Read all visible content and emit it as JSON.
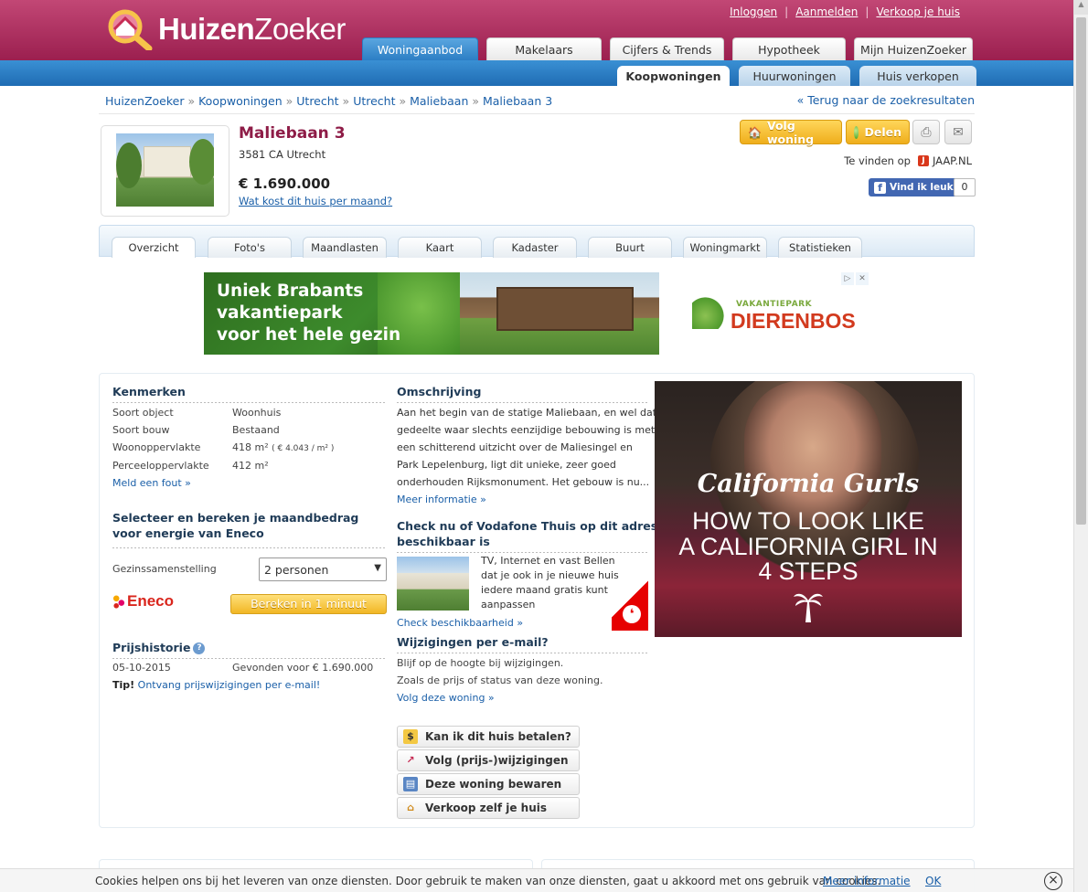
{
  "header": {
    "logo_part1": "Huizen",
    "logo_part2": "Zoeker",
    "top_links": [
      "Inloggen",
      "Aanmelden",
      "Verkoop je huis"
    ],
    "main_tabs": [
      "Woningaanbod",
      "Makelaars",
      "Cijfers & Trends",
      "Hypotheek",
      "Mijn HuizenZoeker"
    ],
    "sub_tabs": [
      "Koopwoningen",
      "Huurwoningen",
      "Huis verkopen"
    ]
  },
  "breadcrumb": [
    "HuizenZoeker",
    "Koopwoningen",
    "Utrecht",
    "Utrecht",
    "Maliebaan",
    "Maliebaan 3"
  ],
  "back_link": "« Terug naar de zoekresultaten",
  "listing": {
    "title": "Maliebaan 3",
    "address": "3581 CA Utrecht",
    "price": "€ 1.690.000",
    "cost_link": "Wat kost dit huis per maand?",
    "follow_button": "Volg woning",
    "share_button": "Delen",
    "found_on_label": "Te vinden op",
    "found_on_site": "JAAP.NL",
    "fb_like": "Vind ik leuk",
    "fb_count": "0"
  },
  "page_tabs": [
    "Overzicht",
    "Foto's",
    "Maandlasten",
    "Kaart",
    "Kadaster",
    "Buurt",
    "Woningmarkt",
    "Statistieken"
  ],
  "ad_banner": {
    "slogan_line1": "Uniek Brabants",
    "slogan_line2": "vakantiepark",
    "slogan_line3": "voor het hele gezin",
    "brand_small": "VAKANTIEPARK",
    "brand_big": "DIERENBOS"
  },
  "kenmerken": {
    "heading": "Kenmerken",
    "rows": [
      {
        "label": "Soort object",
        "value": "Woonhuis"
      },
      {
        "label": "Soort bouw",
        "value": "Bestaand"
      },
      {
        "label": "Woonoppervlakte",
        "value": "418 m²",
        "extra": "( € 4.043 / m² )"
      },
      {
        "label": "Perceeloppervlakte",
        "value": "412 m²"
      }
    ],
    "report_link": "Meld een fout »"
  },
  "energy": {
    "heading_line1": "Selecteer en bereken je maandbedrag",
    "heading_line2": "voor energie van Eneco",
    "household_label": "Gezinssamenstelling",
    "household_value": "2 personen",
    "brand": "Eneco",
    "calc_button": "Bereken in 1 minuut"
  },
  "price_history": {
    "heading": "Prijshistorie",
    "date": "05-10-2015",
    "entry": "Gevonden voor € 1.690.000",
    "tip_label": "Tip!",
    "tip_link": "Ontvang prijswijzigingen per e-mail!"
  },
  "description": {
    "heading": "Omschrijving",
    "lines": [
      "Aan het begin van de statige Maliebaan, en wel dat",
      "gedeelte waar slechts eenzijdige bebouwing is met",
      "een schitterend uitzicht over de Maliesingel en",
      "Park Lepelenburg, ligt dit unieke, zeer goed",
      "onderhouden Rijksmonument. Het gebouw is nu..."
    ],
    "more_link": "Meer informatie »"
  },
  "vodafone": {
    "heading_line1": "Check nu of Vodafone Thuis op dit adres",
    "heading_line2": "beschikbaar is",
    "lines": [
      "TV, Internet en vast Bellen",
      "dat je ook in je nieuwe huis",
      "iedere maand gratis kunt",
      "aanpassen"
    ],
    "link": "Check beschikbaarheid »"
  },
  "email_changes": {
    "heading": "Wijzigingen per e-mail?",
    "line1": "Blijf op de hoogte bij wijzigingen.",
    "line2": "Zoals de prijs of status van deze woning.",
    "link": "Volg deze woning »"
  },
  "action_buttons": [
    "Kan ik dit huis betalen?",
    "Volg (prijs-)wijzigingen",
    "Deze woning bewaren",
    "Verkoop zelf je huis"
  ],
  "ad_square": {
    "title": "California Gurls",
    "line1": "HOW TO LOOK LIKE",
    "line2": "A CALIFORNIA GIRL IN",
    "line3": "4 STEPS"
  },
  "cookie_bar": {
    "message": "Cookies helpen ons bij het leveren van onze diensten. Door gebruik te maken van onze diensten, gaat u akkoord met ons gebruik van cookies.",
    "more_link": "Meer informatie",
    "ok_link": "OK",
    "close": "×"
  }
}
